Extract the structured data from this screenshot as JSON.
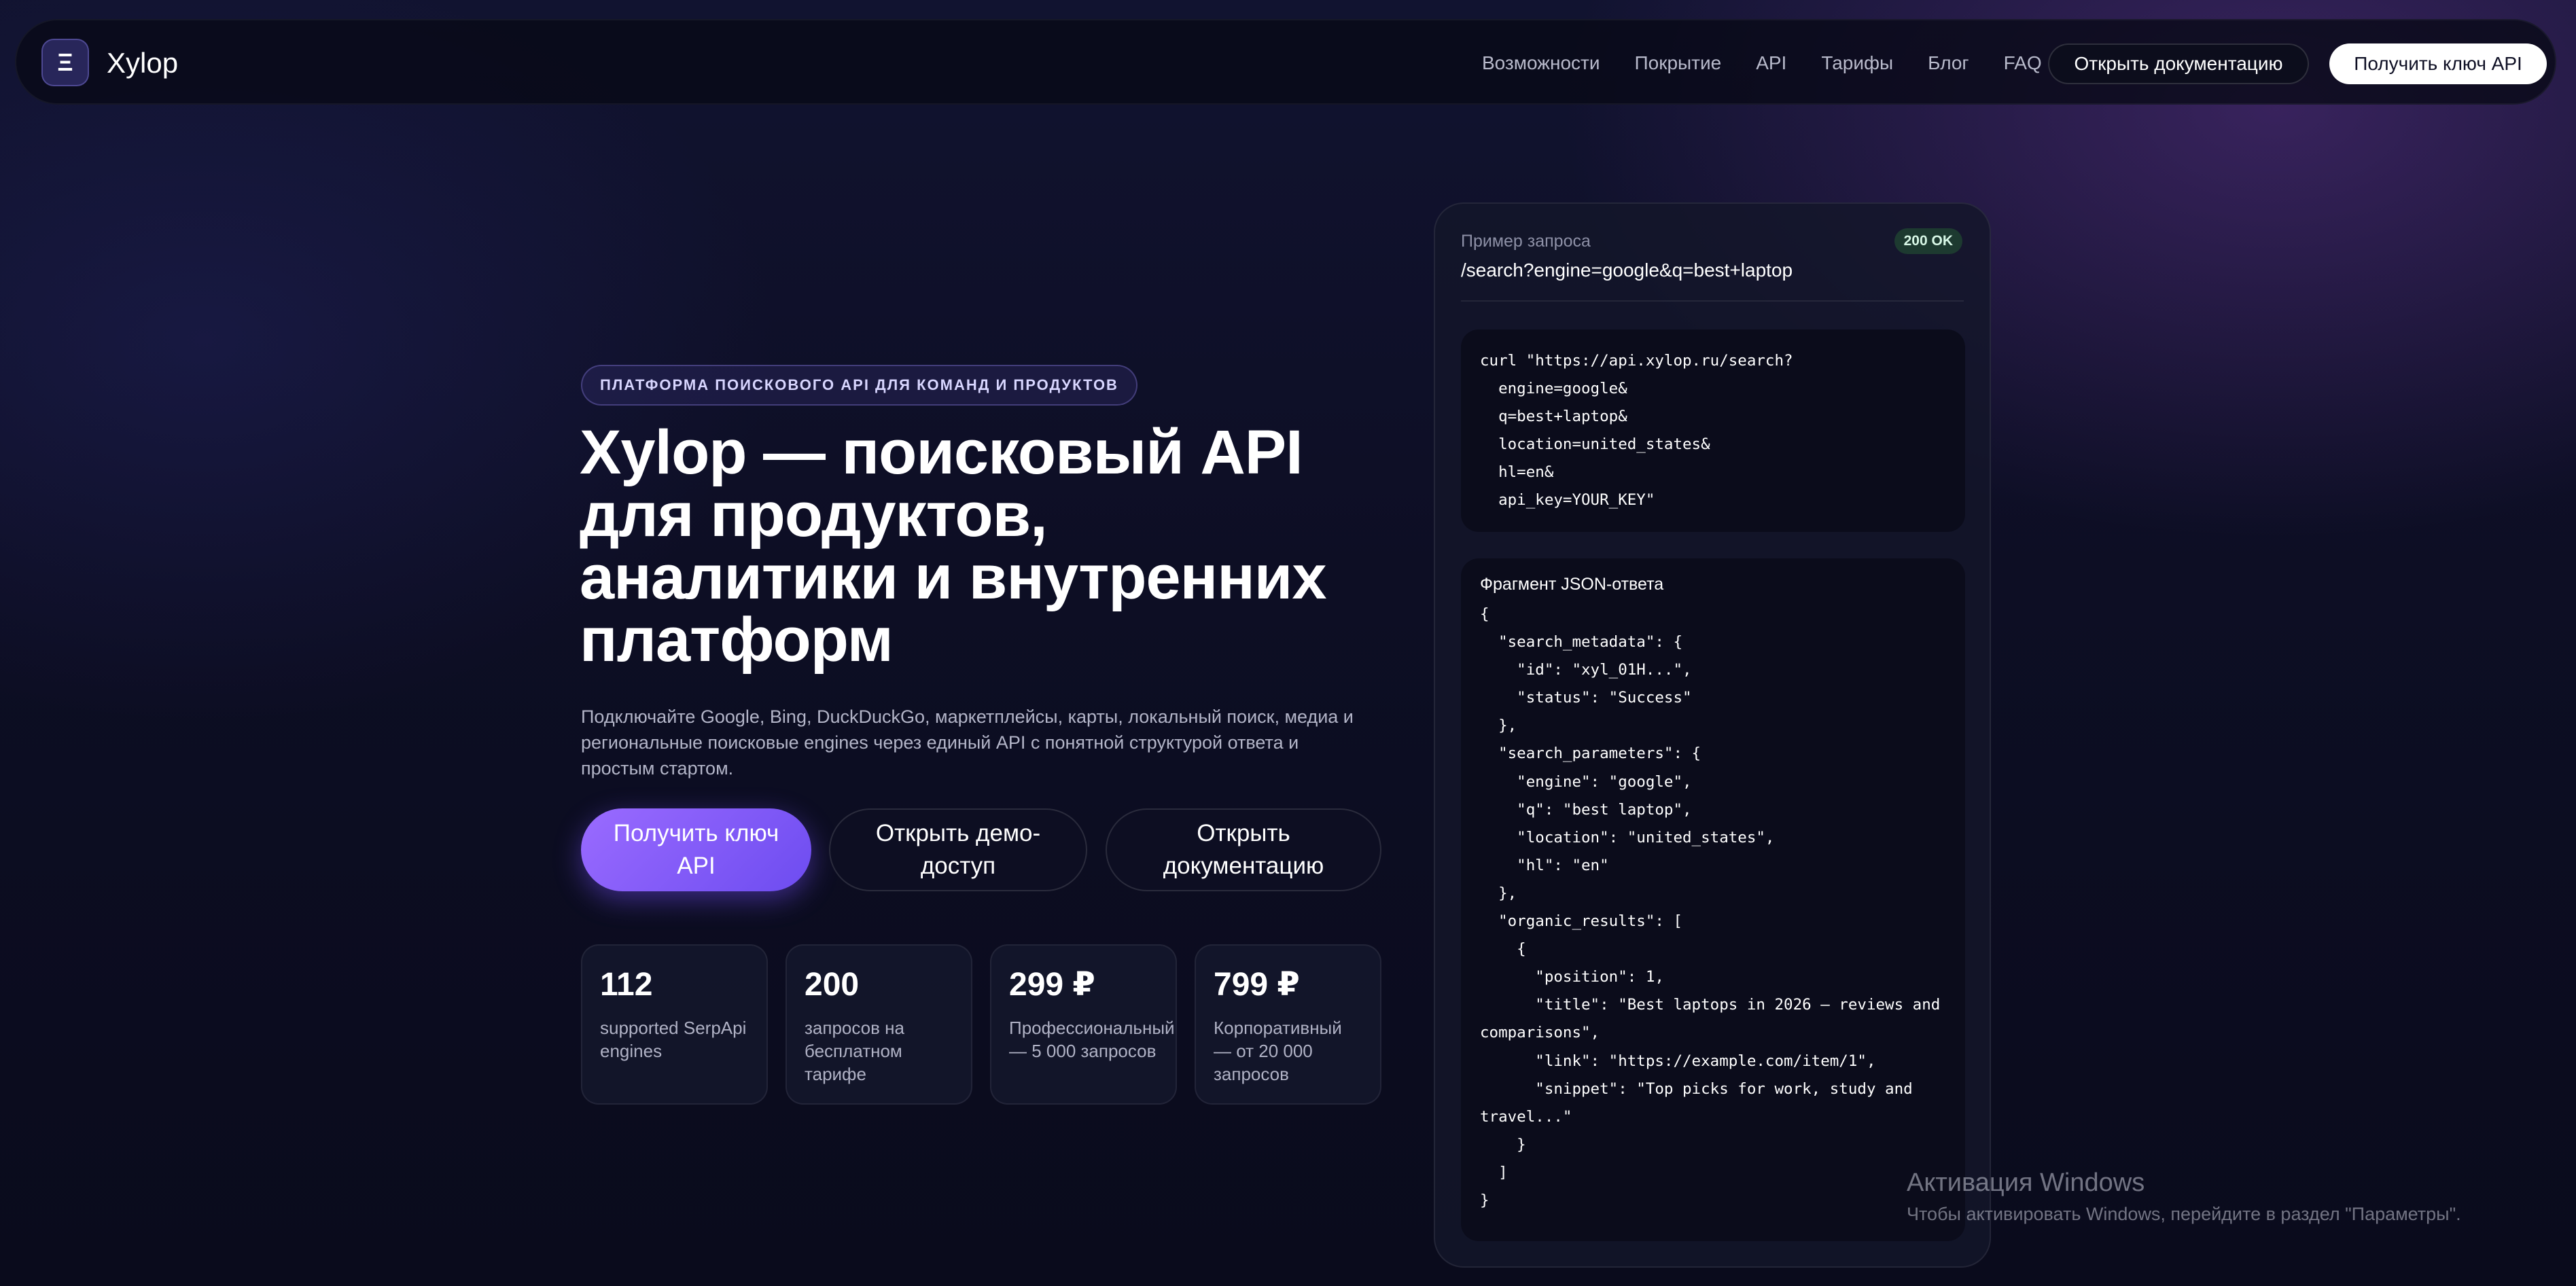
{
  "header": {
    "logo_glyph": "Ξ",
    "logo_text": "Xylop",
    "nav": [
      "Возможности",
      "Покрытие",
      "API",
      "Тарифы",
      "Блог",
      "FAQ"
    ],
    "docs_button": "Открыть документацию",
    "key_button": "Получить ключ API"
  },
  "hero": {
    "badge": "ПЛАТФОРМА ПОИСКОВОГО API ДЛЯ КОМАНД И ПРОДУКТОВ",
    "title": "Xylop — поисковый API для продуктов, аналитики и внутренних платформ",
    "description": "Подключайте Google, Bing, DuckDuckGo, маркетплейсы, карты, локальный поиск, медиа и региональные поисковые engines через единый API с понятной структурой ответа и простым стартом.",
    "buttons": {
      "primary": "Получить ключ API",
      "demo": "Открыть демо-доступ",
      "docs": "Открыть документацию"
    },
    "stats": [
      {
        "value": "112",
        "label": "supported SerpApi engines"
      },
      {
        "value": "200",
        "label": "запросов на бесплатном тарифе"
      },
      {
        "value": "299 ₽",
        "label": "Профессиональный — 5 000 запросов"
      },
      {
        "value": "799 ₽",
        "label": "Корпоративный — от 20 000 запросов"
      }
    ]
  },
  "panel": {
    "caption": "Пример запроса",
    "status": "200 OK",
    "endpoint": "/search?engine=google&q=best+laptop",
    "curl_code": "curl \"https://api.xylop.ru/search?\n  engine=google&\n  q=best+laptop&\n  location=united_states&\n  hl=en&\n  api_key=YOUR_KEY\"",
    "json_title": "Фрагмент JSON-ответа",
    "json_code": "{\n  \"search_metadata\": {\n    \"id\": \"xyl_01H...\",\n    \"status\": \"Success\"\n  },\n  \"search_parameters\": {\n    \"engine\": \"google\",\n    \"q\": \"best laptop\",\n    \"location\": \"united_states\",\n    \"hl\": \"en\"\n  },\n  \"organic_results\": [\n    {\n      \"position\": 1,\n      \"title\": \"Best laptops in 2026 — reviews and\ncomparisons\",\n      \"link\": \"https://example.com/item/1\",\n      \"snippet\": \"Top picks for work, study and\ntravel...\"\n    }\n  ]\n}"
  },
  "watermark": {
    "title": "Активация Windows",
    "subtitle": "Чтобы активировать Windows, перейдите в раздел \"Параметры\"."
  }
}
